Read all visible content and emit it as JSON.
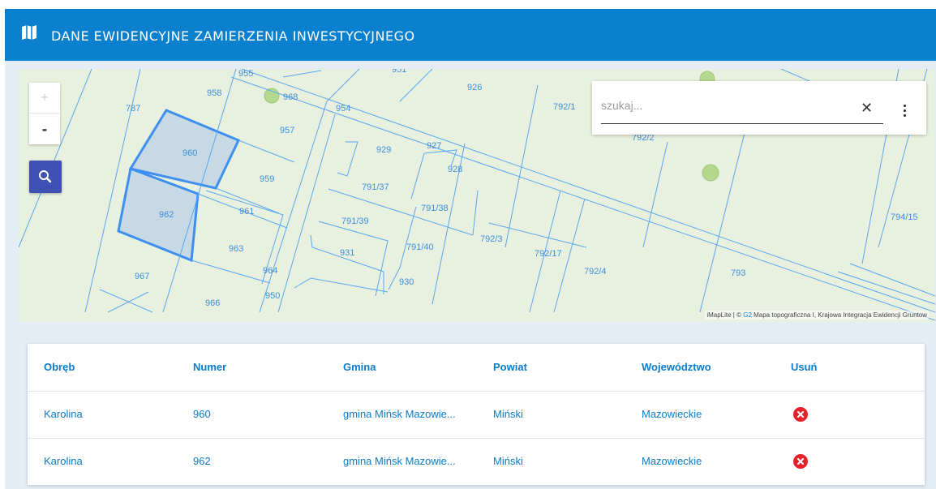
{
  "header": {
    "title": "DANE EWIDENCYJNE ZAMIERZENIA INWESTYCYJNEGO",
    "icon": "map-icon"
  },
  "map": {
    "zoom_in_label": "+",
    "zoom_out_label": "-",
    "search_icon": "search-icon",
    "search_placeholder": "szukaj...",
    "clear_label": "✕",
    "attribution": {
      "prefix": "iMapLite | © ",
      "g2": "G2",
      "rest": " Mapa topograficzna I, Krajowa Integracja Ewidencji Gruntow"
    },
    "parcel_labels": [
      "955",
      "951",
      "958",
      "968",
      "926",
      "792/1",
      "787",
      "954",
      "957",
      "792/2",
      "960",
      "929",
      "927",
      "928",
      "959",
      "791/37",
      "961",
      "791/38",
      "962",
      "791/39",
      "794/15",
      "792/3",
      "963",
      "931",
      "791/40",
      "792/17",
      "964",
      "792/4",
      "793",
      "967",
      "930",
      "950",
      "966"
    ],
    "colors": {
      "parcel_line": "#5aa7ee",
      "selected_fill": "#c8d9e6",
      "selected_stroke": "#3d8ff0",
      "map_bg": "#e8f0df"
    }
  },
  "table": {
    "headers": [
      "Obręb",
      "Numer",
      "Gmina",
      "Powiat",
      "Województwo",
      "Usuń"
    ],
    "rows": [
      {
        "obreb": "Karolina",
        "numer": "960",
        "gmina": "gmina Mińsk Mazowie...",
        "powiat": "Miński",
        "wojewodztwo": "Mazowieckie"
      },
      {
        "obreb": "Karolina",
        "numer": "962",
        "gmina": "gmina Mińsk Mazowie...",
        "powiat": "Miński",
        "wojewodztwo": "Mazowieckie"
      }
    ],
    "delete_icon": "delete-circle-icon",
    "colors": {
      "text": "#0a7cc9",
      "delete": "#e8202a"
    }
  },
  "colors": {
    "header_bg": "#0a80cf",
    "page_bg": "#e4edf6"
  }
}
